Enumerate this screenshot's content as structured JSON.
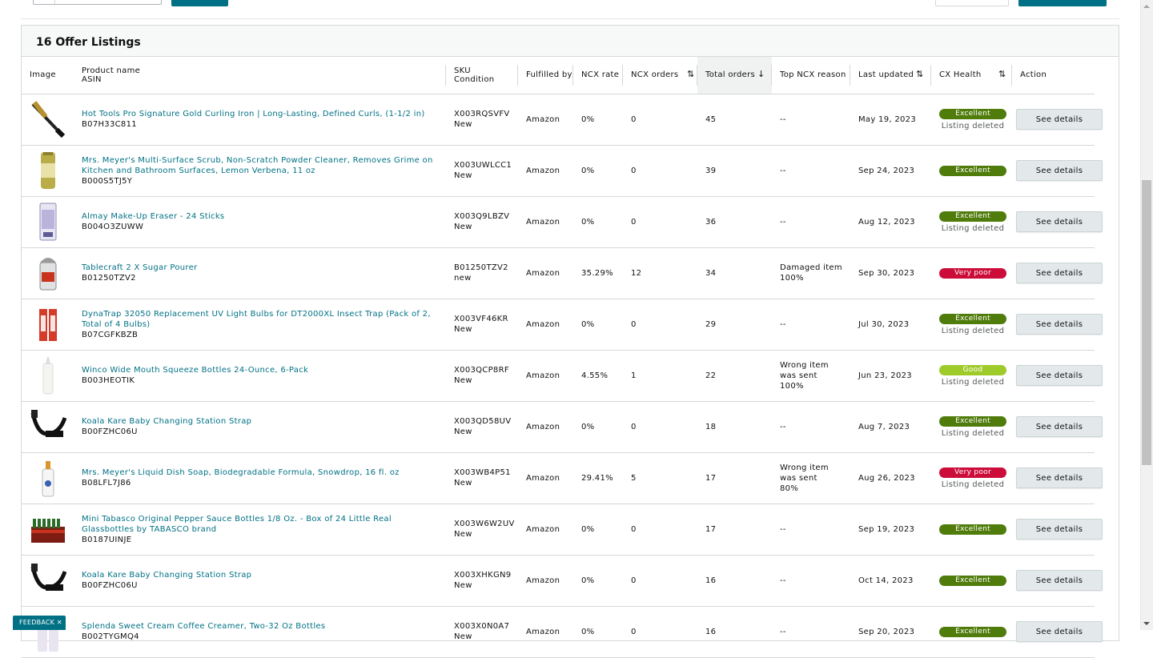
{
  "panel": {
    "title": "16 Offer Listings"
  },
  "columns": {
    "image": "Image",
    "product_name": "Product name",
    "asin": "ASIN",
    "sku": "SKU",
    "condition": "Condition",
    "fulfilled_by": "Fulfilled by",
    "ncx_rate": "NCX rate",
    "ncx_orders": "NCX orders",
    "total_orders": "Total orders",
    "top_ncx_reason": "Top NCX reason",
    "last_updated": "Last updated",
    "cx_health": "CX Health",
    "action": "Action"
  },
  "icons": {
    "sort_both": "sort-both-arrows-icon",
    "sort_down": "sort-descending-arrow-icon",
    "close": "close-icon"
  },
  "colors": {
    "link": "#007185",
    "excellent": "#507c0c",
    "good": "#9fcb2a",
    "very_poor": "#cc0c39"
  },
  "rows": [
    {
      "name": "Hot Tools Pro Signature Gold Curling Iron | Long-Lasting, Defined Curls, (1-1/2 in)",
      "asin": "B07H33C811",
      "sku": "X003RQSVFV",
      "condition": "New",
      "fulfilled": "Amazon",
      "ncx_rate": "0%",
      "ncx_orders": "0",
      "total": "45",
      "reason": "--",
      "updated": "May 19, 2023",
      "health": "Excellent",
      "health_color": "#507c0c",
      "note": "Listing deleted",
      "action": "See details"
    },
    {
      "name": "Mrs. Meyer's Multi-Surface Scrub, Non-Scratch Powder Cleaner, Removes Grime on Kitchen and Bathroom Surfaces, Lemon Verbena, 11 oz",
      "asin": "B000S5TJ5Y",
      "sku": "X003UWLCC1",
      "condition": "New",
      "fulfilled": "Amazon",
      "ncx_rate": "0%",
      "ncx_orders": "0",
      "total": "39",
      "reason": "--",
      "updated": "Sep 24, 2023",
      "health": "Excellent",
      "health_color": "#507c0c",
      "note": "",
      "action": "See details"
    },
    {
      "name": "Almay Make-Up Eraser - 24 Sticks",
      "asin": "B004O3ZUWW",
      "sku": "X003Q9LBZV",
      "condition": "New",
      "fulfilled": "Amazon",
      "ncx_rate": "0%",
      "ncx_orders": "0",
      "total": "36",
      "reason": "--",
      "updated": "Aug 12, 2023",
      "health": "Excellent",
      "health_color": "#507c0c",
      "note": "Listing deleted",
      "action": "See details"
    },
    {
      "name": "Tablecraft 2 X Sugar Pourer",
      "asin": "B01250TZV2",
      "sku": "B01250TZV2",
      "condition": "new",
      "fulfilled": "Amazon",
      "ncx_rate": "35.29%",
      "ncx_orders": "12",
      "total": "34",
      "reason": "Damaged item",
      "reason_pct": "100%",
      "updated": "Sep 30, 2023",
      "health": "Very poor",
      "health_color": "#cc0c39",
      "note": "",
      "action": "See details"
    },
    {
      "name": "DynaTrap 32050 Replacement UV Light Bulbs for DT2000XL Insect Trap (Pack of 2, Total of 4 Bulbs)",
      "asin": "B07CGFKBZB",
      "sku": "X003VF46KR",
      "condition": "New",
      "fulfilled": "Amazon",
      "ncx_rate": "0%",
      "ncx_orders": "0",
      "total": "29",
      "reason": "--",
      "updated": "Jul 30, 2023",
      "health": "Excellent",
      "health_color": "#507c0c",
      "note": "Listing deleted",
      "action": "See details"
    },
    {
      "name": "Winco Wide Mouth Squeeze Bottles 24-Ounce, 6-Pack",
      "asin": "B003HEOTIK",
      "sku": "X003QCP8RF",
      "condition": "New",
      "fulfilled": "Amazon",
      "ncx_rate": "4.55%",
      "ncx_orders": "1",
      "total": "22",
      "reason": "Wrong item was sent",
      "reason_pct": "100%",
      "updated": "Jun 23, 2023",
      "health": "Good",
      "health_color": "#9fcb2a",
      "note": "Listing deleted",
      "action": "See details"
    },
    {
      "name": "Koala Kare Baby Changing Station Strap",
      "asin": "B00FZHC06U",
      "sku": "X003QD58UV",
      "condition": "New",
      "fulfilled": "Amazon",
      "ncx_rate": "0%",
      "ncx_orders": "0",
      "total": "18",
      "reason": "--",
      "updated": "Aug 7, 2023",
      "health": "Excellent",
      "health_color": "#507c0c",
      "note": "Listing deleted",
      "action": "See details"
    },
    {
      "name": "Mrs. Meyer's Liquid Dish Soap, Biodegradable Formula, Snowdrop, 16 fl. oz",
      "asin": "B08LFL7J86",
      "sku": "X003WB4P51",
      "condition": "New",
      "fulfilled": "Amazon",
      "ncx_rate": "29.41%",
      "ncx_orders": "5",
      "total": "17",
      "reason": "Wrong item was sent",
      "reason_pct": "80%",
      "updated": "Aug 26, 2023",
      "health": "Very poor",
      "health_color": "#cc0c39",
      "note": "Listing deleted",
      "action": "See details"
    },
    {
      "name": "Mini Tabasco Original Pepper Sauce Bottles 1/8 Oz. - Box of 24 Little Real Glassbottles by TABASCO brand",
      "asin": "B0187UINJE",
      "sku": "X003W6W2UV",
      "condition": "New",
      "fulfilled": "Amazon",
      "ncx_rate": "0%",
      "ncx_orders": "0",
      "total": "17",
      "reason": "--",
      "updated": "Sep 19, 2023",
      "health": "Excellent",
      "health_color": "#507c0c",
      "note": "",
      "action": "See details"
    },
    {
      "name": "Koala Kare Baby Changing Station Strap",
      "asin": "B00FZHC06U",
      "sku": "X003XHKGN9",
      "condition": "New",
      "fulfilled": "Amazon",
      "ncx_rate": "0%",
      "ncx_orders": "0",
      "total": "16",
      "reason": "--",
      "updated": "Oct 14, 2023",
      "health": "Excellent",
      "health_color": "#507c0c",
      "note": "",
      "action": "See details"
    },
    {
      "name": "Splenda Sweet Cream Coffee Creamer, Two-32 Oz Bottles",
      "asin": "B002TYGMQ4",
      "sku": "X003X0N0A7",
      "condition": "New",
      "fulfilled": "Amazon",
      "ncx_rate": "0%",
      "ncx_orders": "0",
      "total": "16",
      "reason": "--",
      "updated": "Sep 20, 2023",
      "health": "Excellent",
      "health_color": "#507c0c",
      "note": "",
      "action": "See details"
    }
  ],
  "feedback": {
    "label": "FEEDBACK"
  }
}
